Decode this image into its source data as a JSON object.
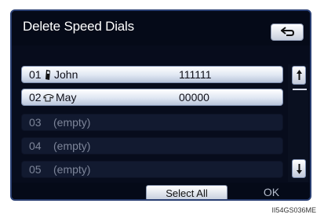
{
  "screen": {
    "title": "Delete Speed Dials",
    "back_icon": "return-arrow-icon"
  },
  "rows": [
    {
      "num": "01",
      "icon": "mobile-phone-icon",
      "name": "John",
      "number": "111111",
      "state": "filled"
    },
    {
      "num": "02",
      "icon": "home-phone-icon",
      "name": "May",
      "number": "00000",
      "state": "filled"
    },
    {
      "num": "03",
      "name": "(empty)",
      "state": "empty"
    },
    {
      "num": "04",
      "name": "(empty)",
      "state": "empty"
    },
    {
      "num": "05",
      "name": "(empty)",
      "state": "empty"
    }
  ],
  "footer": {
    "select_all": "Select All",
    "ok": "OK"
  },
  "image_code": "II54GS036ME",
  "colors": {
    "background": "#070c1c",
    "row_highlight": "#dfe6f2",
    "frame_border": "#2a3f72"
  }
}
